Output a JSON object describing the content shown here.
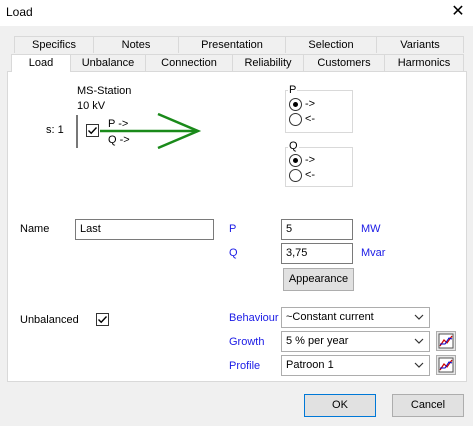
{
  "window": {
    "title": "Load",
    "close_glyph": "✕"
  },
  "tabs_row1": [
    "Specifics",
    "Notes",
    "Presentation",
    "Selection",
    "Variants"
  ],
  "tabs_row2": [
    "Load",
    "Unbalance",
    "Connection",
    "Reliability",
    "Customers",
    "Harmonics"
  ],
  "active_tab": "Load",
  "diagram": {
    "station_name": "MS-Station",
    "voltage": "10 kV",
    "side_label": "s: 1",
    "p_dir": "P ->",
    "q_dir": "Q ->",
    "arrow_color": "#1a8a1a"
  },
  "p_group": {
    "title": "P",
    "options": [
      "->",
      "<-"
    ],
    "selected": 0
  },
  "q_group": {
    "title": "Q",
    "options": [
      "->",
      "<-"
    ],
    "selected": 0
  },
  "name": {
    "label": "Name",
    "value": "Last"
  },
  "p_field": {
    "label": "P",
    "value": "5",
    "unit": "MW"
  },
  "q_field": {
    "label": "Q",
    "value": "3,75",
    "unit": "Mvar"
  },
  "appearance_label": "Appearance",
  "unbalanced": {
    "label": "Unbalanced",
    "checked": true
  },
  "behaviour": {
    "label": "Behaviour",
    "value": "~Constant current"
  },
  "growth": {
    "label": "Growth",
    "value": "5 % per year"
  },
  "profile": {
    "label": "Profile",
    "value": "Patroon 1"
  },
  "buttons": {
    "ok": "OK",
    "cancel": "Cancel"
  },
  "colors": {
    "label_blue": "#1a1ae6",
    "accent": "#0078d7"
  },
  "icons": {
    "chart_icon": "chart-icon",
    "dropdown": "chevron-down-icon"
  }
}
